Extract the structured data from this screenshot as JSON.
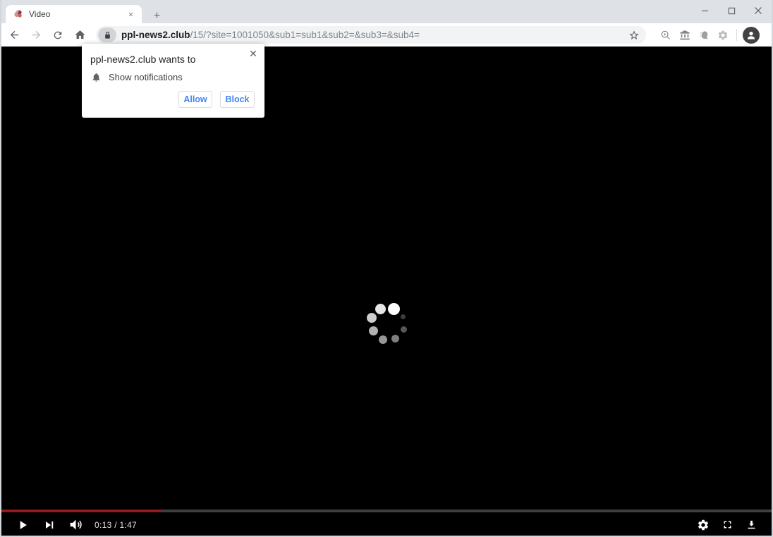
{
  "tab": {
    "title": "Video"
  },
  "toolbar": {
    "url": {
      "domain": "ppl-news2.club",
      "path": "/15/?site=1001050&sub1=sub1&sub2=&sub3=&sub4="
    }
  },
  "permission_dialog": {
    "title": "ppl-news2.club wants to",
    "permission_text": "Show notifications",
    "allow_label": "Allow",
    "block_label": "Block",
    "close_label": "✕"
  },
  "player": {
    "time_display": "0:13 / 1:47",
    "progress_percent": 20.8,
    "state": "loading"
  },
  "colors": {
    "tabstrip_bg": "#dee1e6",
    "toolbar_bg": "#ffffff",
    "omnibox_bg": "#f1f3f4",
    "page_bg": "#000000",
    "dialog_button_blue": "#4285f4",
    "progress_red": "#a51d23",
    "progress_track": "#3f3f3f"
  }
}
